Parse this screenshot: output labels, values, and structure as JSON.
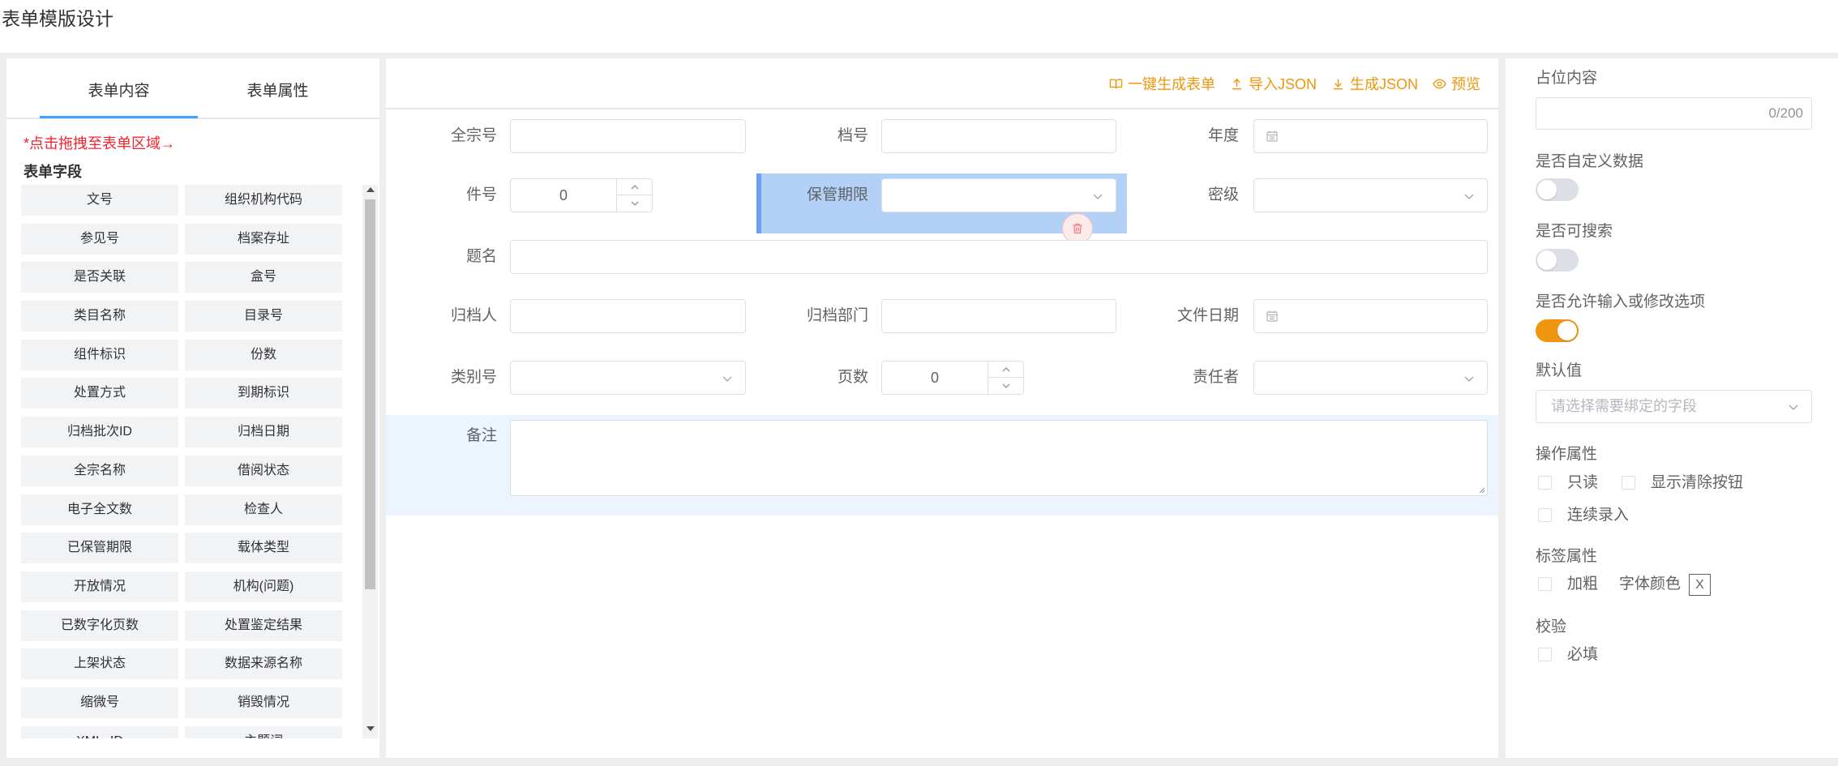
{
  "page": {
    "title": "表单模版设计"
  },
  "left_panel": {
    "tabs": [
      {
        "label": "表单内容",
        "active": true
      },
      {
        "label": "表单属性",
        "active": false
      }
    ],
    "hint": "*点击拖拽至表单区域→",
    "section_title": "表单字段",
    "fields": [
      "文号",
      "组织机构代码",
      "参见号",
      "档案存址",
      "是否关联",
      "盒号",
      "类目名称",
      "目录号",
      "组件标识",
      "份数",
      "处置方式",
      "到期标识",
      "归档批次ID",
      "归档日期",
      "全宗名称",
      "借阅状态",
      "电子全文数",
      "检查人",
      "已保管期限",
      "载体类型",
      "开放情况",
      "机构(问题)",
      "已数字化页数",
      "处置鉴定结果",
      "上架状态",
      "数据来源名称",
      "缩微号",
      "销毁情况",
      "XML_ID",
      "主题词"
    ]
  },
  "toolbar": {
    "actions": [
      {
        "label": "一键生成表单",
        "icon": "book-icon"
      },
      {
        "label": "导入JSON",
        "icon": "upload-icon"
      },
      {
        "label": "生成JSON",
        "icon": "download-icon"
      },
      {
        "label": "预览",
        "icon": "eye-icon"
      }
    ]
  },
  "form": {
    "fields": [
      {
        "label": "全宗号",
        "type": "text",
        "value": ""
      },
      {
        "label": "档号",
        "type": "text",
        "value": ""
      },
      {
        "label": "年度",
        "type": "date",
        "value": ""
      },
      {
        "label": "件号",
        "type": "number",
        "value": "0"
      },
      {
        "label": "保管期限",
        "type": "select",
        "value": "",
        "selected": true
      },
      {
        "label": "密级",
        "type": "select",
        "value": ""
      },
      {
        "label": "题名",
        "type": "text",
        "value": ""
      },
      {
        "label": "归档人",
        "type": "text",
        "value": ""
      },
      {
        "label": "归档部门",
        "type": "text",
        "value": ""
      },
      {
        "label": "文件日期",
        "type": "date",
        "value": ""
      },
      {
        "label": "类别号",
        "type": "select",
        "value": ""
      },
      {
        "label": "页数",
        "type": "number",
        "value": "0"
      },
      {
        "label": "责任者",
        "type": "select",
        "value": ""
      },
      {
        "label": "备注",
        "type": "textarea",
        "value": "",
        "active_row": true
      }
    ]
  },
  "properties": {
    "placeholder": {
      "label": "占位内容",
      "value": "",
      "counter": "0/200"
    },
    "custom_data": {
      "label": "是否自定义数据",
      "enabled": false
    },
    "searchable": {
      "label": "是否可搜索",
      "enabled": false
    },
    "allow_input_options": {
      "label": "是否允许输入或修改选项",
      "enabled": true
    },
    "default_value": {
      "label": "默认值",
      "placeholder": "请选择需要绑定的字段",
      "value": ""
    },
    "operation": {
      "label": "操作属性",
      "options": [
        {
          "label": "只读",
          "checked": false
        },
        {
          "label": "显示清除按钮",
          "checked": false
        },
        {
          "label": "连续录入",
          "checked": false
        }
      ]
    },
    "label_attrs": {
      "label": "标签属性",
      "bold": {
        "label": "加粗",
        "checked": false
      },
      "font_color": {
        "label": "字体颜色",
        "value": "X"
      }
    },
    "validation": {
      "label": "校验",
      "required": {
        "label": "必填",
        "checked": false
      }
    }
  },
  "colors": {
    "accent": "#f0960e",
    "selected_field": "#b3d1f6",
    "selected_border": "#6a9ff5",
    "active_row": "#ecf5ff",
    "hint": "#f5222d",
    "tab_ink": "#409eff"
  }
}
